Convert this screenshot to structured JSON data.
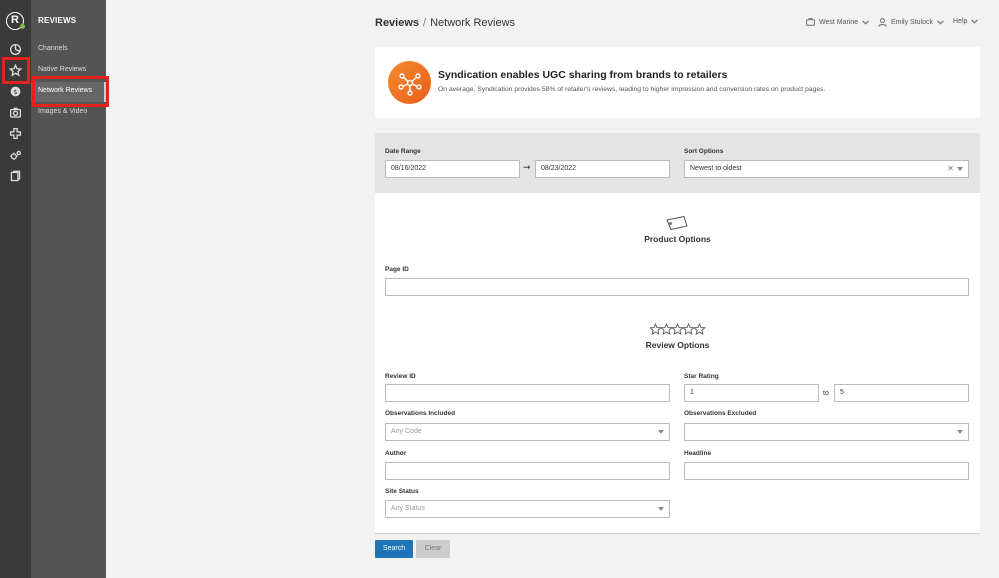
{
  "app": {
    "logo_letter": "R",
    "colors": {
      "accent": "#1f73b7",
      "highlight": "#e2231a",
      "brand_orange": "#f07b2a"
    }
  },
  "rail_icons": [
    "dashboard-icon",
    "star-icon",
    "dollar-icon",
    "camera-icon",
    "plus-icon",
    "settings-icon",
    "document-icon"
  ],
  "nav": {
    "title": "REVIEWS",
    "items": [
      {
        "label": "Channels"
      },
      {
        "label": "Native Reviews"
      },
      {
        "label": "Network Reviews",
        "active": true
      },
      {
        "label": "Images & Video"
      }
    ]
  },
  "breadcrumb": {
    "section": "Reviews",
    "separator": "/",
    "page": "Network Reviews"
  },
  "header": {
    "account": "West Marine",
    "user": "Emily Stulock",
    "help": "Help"
  },
  "banner": {
    "title": "Syndication enables UGC sharing from brands to retailers",
    "text": "On average, Syndication provides 58% of retailer's reviews, leading to higher impression and conversion rates on product pages."
  },
  "filters": {
    "date_range_label": "Date Range",
    "date_from": "08/16/2022",
    "date_to": "08/23/2022",
    "sort_label": "Sort Options",
    "sort_value": "Newest to oldest"
  },
  "product_options": {
    "title": "Product Options",
    "page_id_label": "Page ID",
    "page_id_value": ""
  },
  "review_options": {
    "title": "Review Options",
    "review_id_label": "Review ID",
    "review_id_value": "",
    "star_rating_label": "Star Rating",
    "star_min": "1",
    "star_to": "to",
    "star_max": "5",
    "obs_included_label": "Observations Included",
    "obs_included_placeholder": "Any Code",
    "obs_excluded_label": "Observations Excluded",
    "obs_excluded_value": "",
    "author_label": "Author",
    "author_value": "",
    "headline_label": "Headline",
    "headline_value": "",
    "site_status_label": "Site Status",
    "site_status_placeholder": "Any Status"
  },
  "actions": {
    "search": "Search",
    "clear": "Clear"
  }
}
